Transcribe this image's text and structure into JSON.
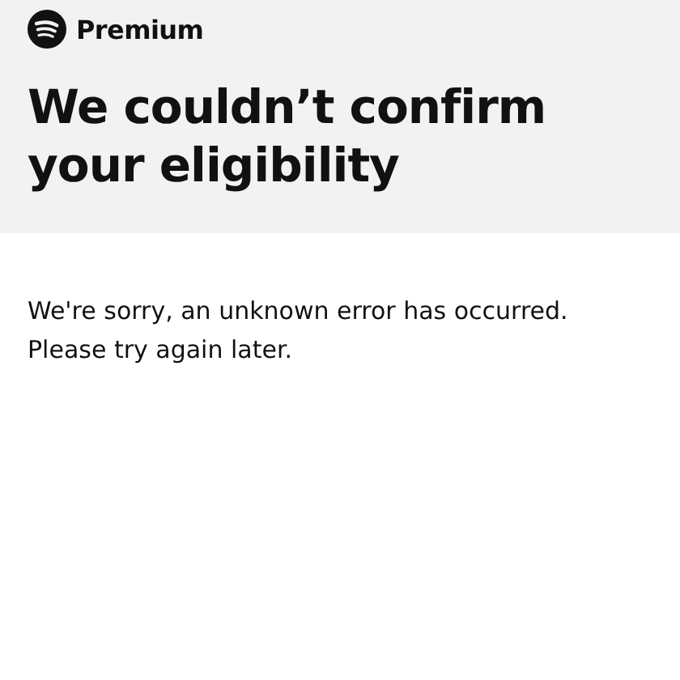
{
  "header": {
    "brand": "Premium",
    "title": "We couldn’t confirm your eligibility"
  },
  "message": "We're sorry, an unknown error has occurred. Please try again later."
}
